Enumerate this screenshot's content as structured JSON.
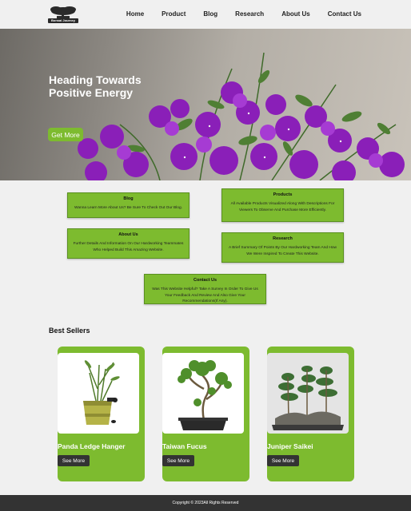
{
  "header": {
    "logo_text": "Bonsai Journey",
    "nav": [
      "Home",
      "Product",
      "Blog",
      "Research",
      "About Us",
      "Contact Us"
    ]
  },
  "hero": {
    "title": "Heading Towards Positive Energy",
    "button": "Get More"
  },
  "cards": {
    "blog": {
      "title": "Blog",
      "text": "Wanna Learn More About Us? Be Sure To Check Out Our Blog."
    },
    "products": {
      "title": "Products",
      "text": "All Available Products Visualized Along With Descriptions For Viewers To Observe And Purchase More Efficiently."
    },
    "about": {
      "title": "About Us",
      "text": "Further Details And Information On Our Hardworking Teammates Who Helped Build This Amazing Website."
    },
    "research": {
      "title": "Research",
      "text": "A Brief Summary Of Points By Our Hardworking Team And How We Were Inspired To Create This Website."
    },
    "contact": {
      "title": "Contact Us",
      "text": "Was This Website Helpful? Take A Survey In Order To Give Us Your Feedback And Review And Also Give Your Recommendations(If Any)."
    }
  },
  "best_sellers": {
    "title": "Best Sellers",
    "items": [
      {
        "name": "Panda Ledge Hanger",
        "button": "See More"
      },
      {
        "name": "Taiwan Fucus",
        "button": "See More"
      },
      {
        "name": "Juniper Saikei",
        "button": "See More"
      }
    ]
  },
  "footer": {
    "copyright": "Copyright © 2023All Rights Reserved"
  },
  "colors": {
    "accent": "#7dbb2f",
    "dark": "#333333",
    "background": "#f0f0f0"
  }
}
